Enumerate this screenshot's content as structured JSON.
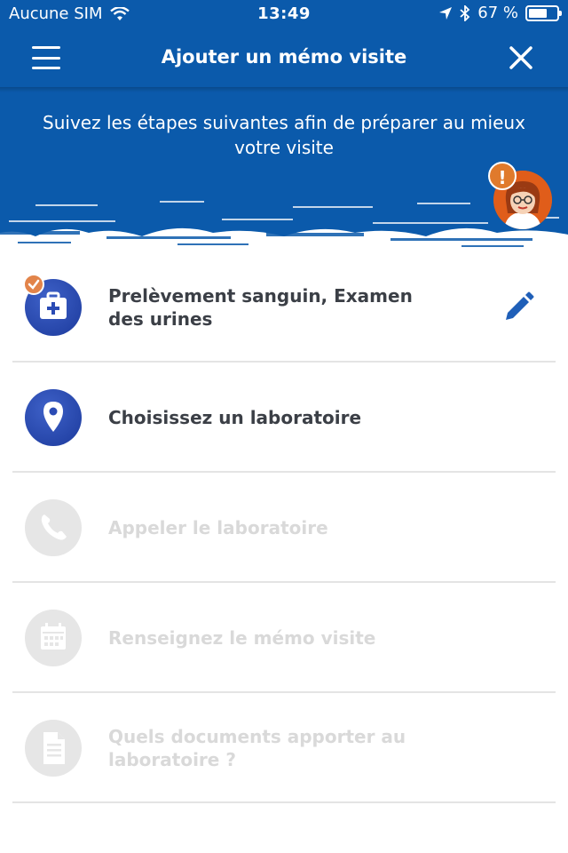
{
  "status_bar": {
    "carrier": "Aucune SIM",
    "time": "13:49",
    "battery": "67 %",
    "battery_level": 0.67
  },
  "navbar": {
    "title": "Ajouter un mémo visite",
    "menu_icon": "hamburger-icon",
    "close_icon": "close-icon"
  },
  "intro": {
    "text": "Suivez les étapes suivantes afin de préparer au mieux votre visite"
  },
  "avatar": {
    "badge": "!"
  },
  "colors": {
    "primary_blue": "#0b5aab",
    "active_icon": "#2a4bb4",
    "disabled_icon": "#e6e6e6",
    "disabled_text": "#d9d9d9",
    "check_orange": "#e2844a"
  },
  "steps": [
    {
      "label": "Prelèvement sanguin, Examen des urines",
      "icon": "medical-kit-icon",
      "state": "completed",
      "editable": true
    },
    {
      "label": "Choisissez un laboratoire",
      "icon": "location-pin-icon",
      "state": "active",
      "editable": false
    },
    {
      "label": "Appeler le laboratoire",
      "icon": "phone-icon",
      "state": "disabled",
      "editable": false
    },
    {
      "label": "Renseignez le mémo visite",
      "icon": "calendar-icon",
      "state": "disabled",
      "editable": false
    },
    {
      "label": "Quels documents apporter au laboratoire ?",
      "icon": "document-icon",
      "state": "disabled",
      "editable": false
    }
  ]
}
